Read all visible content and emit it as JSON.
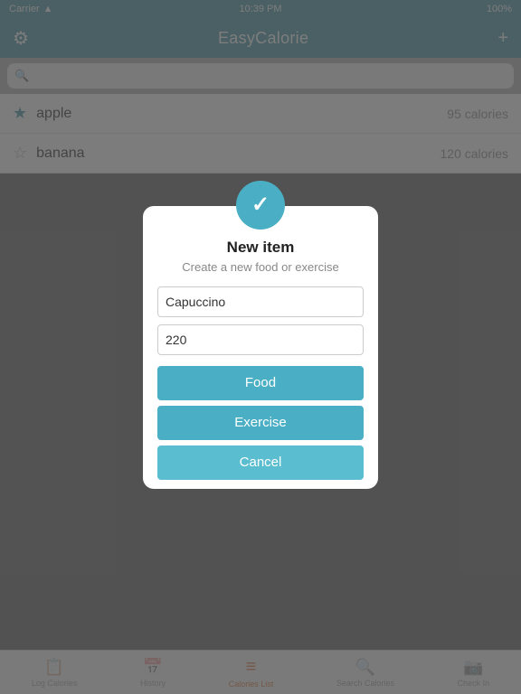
{
  "statusBar": {
    "carrier": "Carrier",
    "time": "10:39 PM",
    "battery": "100%"
  },
  "navBar": {
    "title": "EasyCalorie",
    "gearIcon": "⚙",
    "plusIcon": "+"
  },
  "searchBar": {
    "placeholder": ""
  },
  "listItems": [
    {
      "name": "apple",
      "calories": "95 calories",
      "starred": true
    },
    {
      "name": "banana",
      "calories": "120 calories",
      "starred": false
    }
  ],
  "dialog": {
    "iconCheck": "✓",
    "title": "New item",
    "subtitle": "Create a new food or exercise",
    "nameInputValue": "Capuccino",
    "caloriesInputValue": "220",
    "foodLabel": "Food",
    "exerciseLabel": "Exercise",
    "cancelLabel": "Cancel"
  },
  "tabBar": {
    "tabs": [
      {
        "icon": "📋",
        "label": "Log Calories",
        "active": false
      },
      {
        "icon": "📅",
        "label": "History",
        "active": false
      },
      {
        "icon": "≡",
        "label": "Calories List",
        "active": true
      },
      {
        "icon": "🔍",
        "label": "Search Calories",
        "active": false
      },
      {
        "icon": "📷",
        "label": "Check In",
        "active": false
      }
    ]
  }
}
